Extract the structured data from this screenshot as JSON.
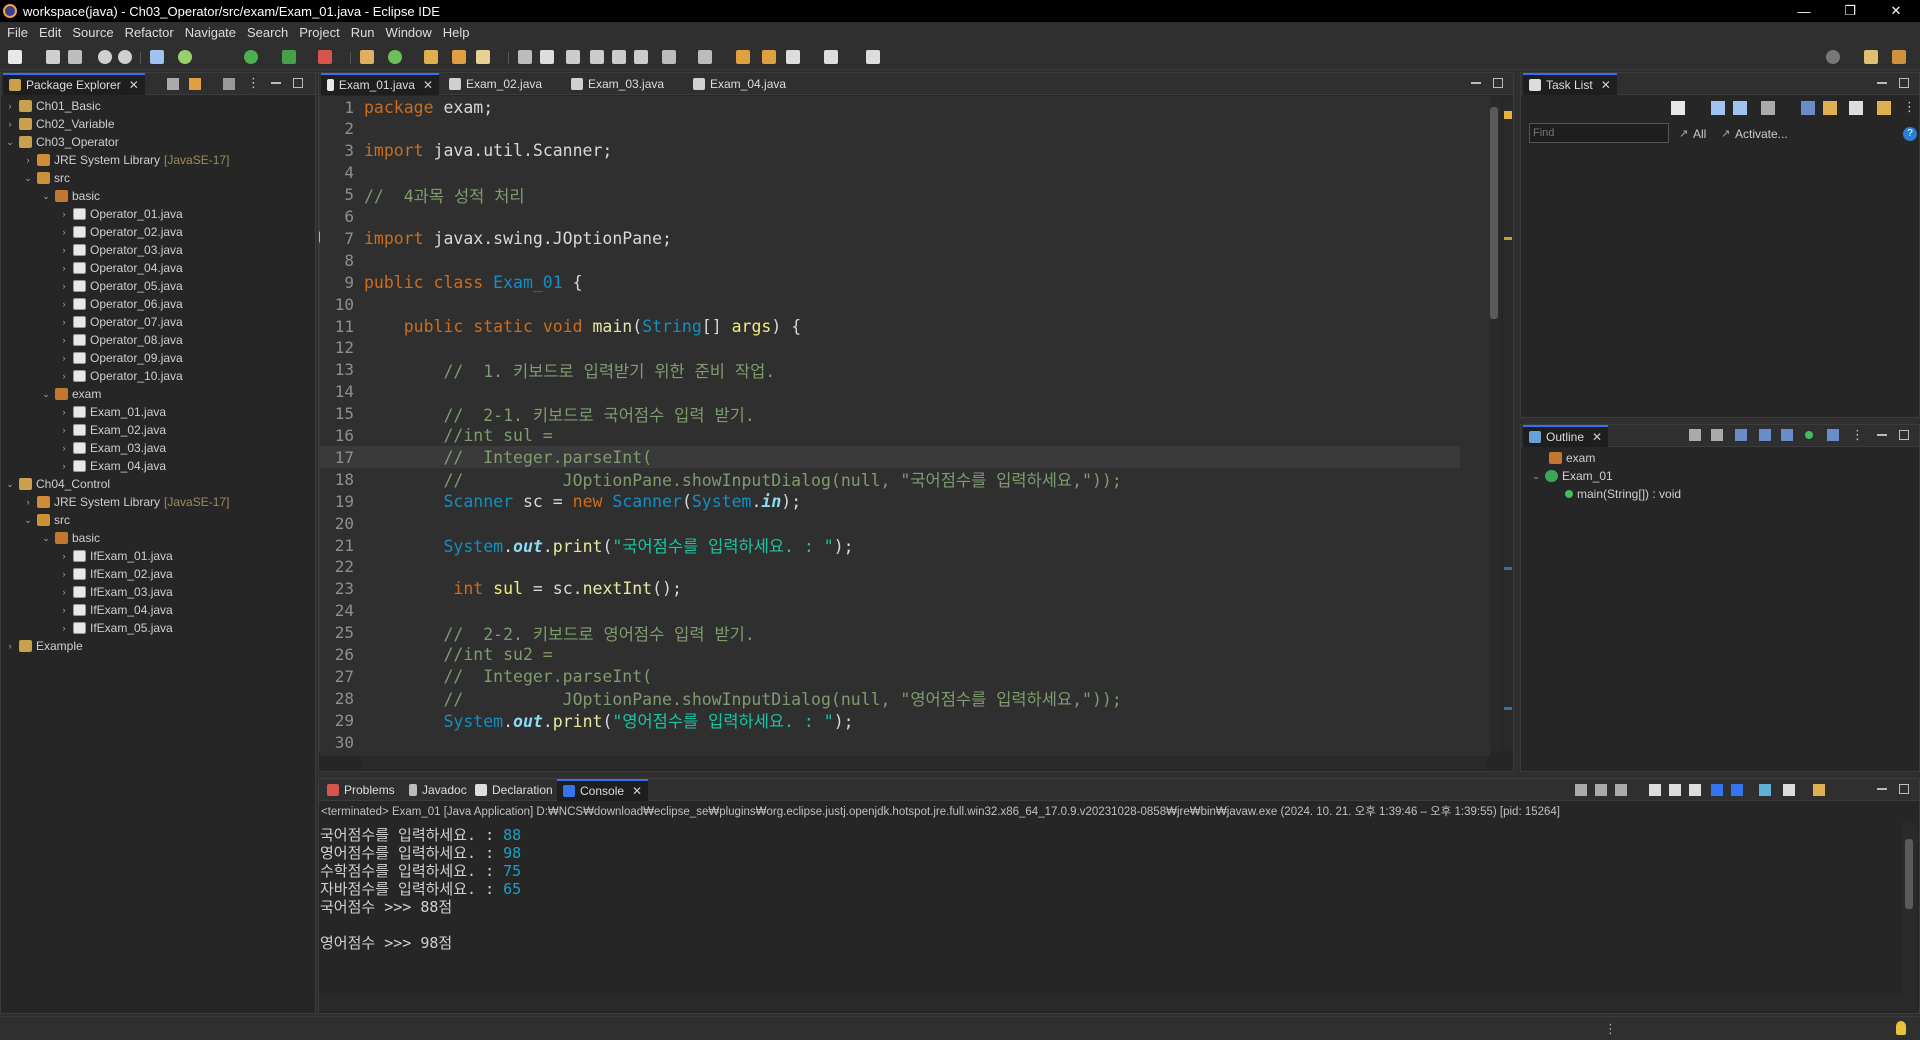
{
  "window": {
    "title": "workspace(java) - Ch03_Operator/src/exam/Exam_01.java - Eclipse IDE",
    "controls": [
      "—",
      "❐",
      "✕"
    ]
  },
  "menu": [
    "File",
    "Edit",
    "Source",
    "Refactor",
    "Navigate",
    "Search",
    "Project",
    "Run",
    "Window",
    "Help"
  ],
  "package_explorer": {
    "tab_label": "Package Explorer",
    "rows": [
      {
        "indent": 0,
        "twisty": "›",
        "icon": "proj",
        "label": "Ch01_Basic",
        "extra": ""
      },
      {
        "indent": 0,
        "twisty": "›",
        "icon": "proj",
        "label": "Ch02_Variable",
        "extra": ""
      },
      {
        "indent": 0,
        "twisty": "⌄",
        "icon": "proj",
        "label": "Ch03_Operator",
        "extra": ""
      },
      {
        "indent": 1,
        "twisty": "›",
        "icon": "lib",
        "label": "JRE System Library",
        "extra": "[JavaSE-17]"
      },
      {
        "indent": 1,
        "twisty": "⌄",
        "icon": "src",
        "label": "src",
        "extra": ""
      },
      {
        "indent": 2,
        "twisty": "⌄",
        "icon": "pkg",
        "label": "basic",
        "extra": ""
      },
      {
        "indent": 3,
        "twisty": "›",
        "icon": "java",
        "label": "Operator_01.java",
        "extra": ""
      },
      {
        "indent": 3,
        "twisty": "›",
        "icon": "java",
        "label": "Operator_02.java",
        "extra": ""
      },
      {
        "indent": 3,
        "twisty": "›",
        "icon": "java",
        "label": "Operator_03.java",
        "extra": ""
      },
      {
        "indent": 3,
        "twisty": "›",
        "icon": "java",
        "label": "Operator_04.java",
        "extra": ""
      },
      {
        "indent": 3,
        "twisty": "›",
        "icon": "java",
        "label": "Operator_05.java",
        "extra": ""
      },
      {
        "indent": 3,
        "twisty": "›",
        "icon": "java",
        "label": "Operator_06.java",
        "extra": ""
      },
      {
        "indent": 3,
        "twisty": "›",
        "icon": "java",
        "label": "Operator_07.java",
        "extra": ""
      },
      {
        "indent": 3,
        "twisty": "›",
        "icon": "java",
        "label": "Operator_08.java",
        "extra": ""
      },
      {
        "indent": 3,
        "twisty": "›",
        "icon": "java",
        "label": "Operator_09.java",
        "extra": ""
      },
      {
        "indent": 3,
        "twisty": "›",
        "icon": "java",
        "label": "Operator_10.java",
        "extra": ""
      },
      {
        "indent": 2,
        "twisty": "⌄",
        "icon": "pkg",
        "label": "exam",
        "extra": ""
      },
      {
        "indent": 3,
        "twisty": "›",
        "icon": "java",
        "label": "Exam_01.java",
        "extra": ""
      },
      {
        "indent": 3,
        "twisty": "›",
        "icon": "java",
        "label": "Exam_02.java",
        "extra": ""
      },
      {
        "indent": 3,
        "twisty": "›",
        "icon": "java",
        "label": "Exam_03.java",
        "extra": ""
      },
      {
        "indent": 3,
        "twisty": "›",
        "icon": "java",
        "label": "Exam_04.java",
        "extra": ""
      },
      {
        "indent": 0,
        "twisty": "⌄",
        "icon": "proj",
        "label": "Ch04_Control",
        "extra": ""
      },
      {
        "indent": 1,
        "twisty": "›",
        "icon": "lib",
        "label": "JRE System Library",
        "extra": "[JavaSE-17]"
      },
      {
        "indent": 1,
        "twisty": "⌄",
        "icon": "src",
        "label": "src",
        "extra": ""
      },
      {
        "indent": 2,
        "twisty": "⌄",
        "icon": "pkg",
        "label": "basic",
        "extra": ""
      },
      {
        "indent": 3,
        "twisty": "›",
        "icon": "java",
        "label": "IfExam_01.java",
        "extra": ""
      },
      {
        "indent": 3,
        "twisty": "›",
        "icon": "java",
        "label": "IfExam_02.java",
        "extra": ""
      },
      {
        "indent": 3,
        "twisty": "›",
        "icon": "java",
        "label": "IfExam_03.java",
        "extra": ""
      },
      {
        "indent": 3,
        "twisty": "›",
        "icon": "java",
        "label": "IfExam_04.java",
        "extra": ""
      },
      {
        "indent": 3,
        "twisty": "›",
        "icon": "java",
        "label": "IfExam_05.java",
        "extra": ""
      },
      {
        "indent": 0,
        "twisty": "›",
        "icon": "proj",
        "label": "Example",
        "extra": ""
      }
    ]
  },
  "editor": {
    "tabs": [
      "Exam_01.java",
      "Exam_02.java",
      "Exam_03.java",
      "Exam_04.java"
    ],
    "lines": [
      [
        [
          "kw",
          "package"
        ],
        [
          "pl",
          " exam;"
        ]
      ],
      [],
      [
        [
          "kw",
          "import"
        ],
        [
          "pl",
          " java.util.Scanner;"
        ]
      ],
      [],
      [
        [
          "cm",
          "//  4과목 성적 처리"
        ]
      ],
      [],
      [
        [
          "kw",
          "import"
        ],
        [
          "pl",
          " javax.swing.JOptionPane;"
        ]
      ],
      [],
      [
        [
          "kw",
          "public class "
        ],
        [
          "ty",
          "Exam_01"
        ],
        [
          "pl",
          " {"
        ]
      ],
      [],
      [
        [
          "pl",
          "    "
        ],
        [
          "kw",
          "public static void "
        ],
        [
          "mt",
          "main"
        ],
        [
          "pl",
          "("
        ],
        [
          "ty",
          "String"
        ],
        [
          "pl",
          "[] "
        ],
        [
          "var",
          "args"
        ],
        [
          "pl",
          ") {"
        ]
      ],
      [],
      [
        [
          "cm",
          "        //  1. 키보드로 입력받기 위한 준비 작업."
        ]
      ],
      [],
      [
        [
          "cm",
          "        //  2-1. 키보드로 국어점수 입력 받기."
        ]
      ],
      [
        [
          "cm",
          "        //int sul ="
        ]
      ],
      [
        [
          "cm",
          "        //  Integer.parseInt("
        ]
      ],
      [
        [
          "cm",
          "        //          JOptionPane.showInputDialog(null, \"국어점수를 입력하세요,\"));"
        ]
      ],
      [
        [
          "pl",
          "        "
        ],
        [
          "ty",
          "Scanner"
        ],
        [
          "pl",
          " sc = "
        ],
        [
          "kw",
          "new "
        ],
        [
          "ty",
          "Scanner"
        ],
        [
          "pl",
          "("
        ],
        [
          "ty",
          "System"
        ],
        [
          "pl",
          "."
        ],
        [
          "fld",
          "in"
        ],
        [
          "pl",
          ");"
        ]
      ],
      [],
      [
        [
          "pl",
          "        "
        ],
        [
          "ty",
          "System"
        ],
        [
          "pl",
          "."
        ],
        [
          "fld",
          "out"
        ],
        [
          "pl",
          "."
        ],
        [
          "mt",
          "print"
        ],
        [
          "pl",
          "("
        ],
        [
          "str",
          "\"국어점수를 입력하세요. : \""
        ],
        [
          "pl",
          ");"
        ]
      ],
      [],
      [
        [
          "pl",
          "         "
        ],
        [
          "kw",
          "int "
        ],
        [
          "var",
          "sul"
        ],
        [
          "pl",
          " = sc."
        ],
        [
          "mt",
          "nextInt"
        ],
        [
          "pl",
          "();"
        ]
      ],
      [],
      [
        [
          "cm",
          "        //  2-2. 키보드로 영어점수 입력 받기."
        ]
      ],
      [
        [
          "cm",
          "        //int su2 ="
        ]
      ],
      [
        [
          "cm",
          "        //  Integer.parseInt("
        ]
      ],
      [
        [
          "cm",
          "        //          JOptionPane.showInputDialog(null, \"영어점수를 입력하세요,\"));"
        ]
      ],
      [
        [
          "pl",
          "        "
        ],
        [
          "ty",
          "System"
        ],
        [
          "pl",
          "."
        ],
        [
          "fld",
          "out"
        ],
        [
          "pl",
          "."
        ],
        [
          "mt",
          "print"
        ],
        [
          "pl",
          "("
        ],
        [
          "str",
          "\"영어점수를 입력하세요. : \""
        ],
        [
          "pl",
          ");"
        ]
      ],
      []
    ]
  },
  "task_list": {
    "tab_label": "Task List",
    "find_placeholder": "Find",
    "all_label": "All",
    "activate_label": "Activate..."
  },
  "outline": {
    "tab_label": "Outline",
    "package": "exam",
    "class": "Exam_01",
    "method": "main(String[]) : void"
  },
  "bottom": {
    "tabs": [
      "Problems",
      "Javadoc",
      "Declaration",
      "Console"
    ],
    "status_line": "<terminated> Exam_01 [Java Application] D:₩NCS₩download₩eclipse_se₩plugins₩org.eclipse.justj.openjdk.hotspot.jre.full.win32.x86_64_17.0.9.v20231028-0858₩jre₩bin₩javaw.exe  (2024. 10. 21. 오후 1:39:46 – 오후 1:39:55) [pid: 15264]",
    "console": [
      {
        "text": "국어점수를 입력하세요. : ",
        "input": "88"
      },
      {
        "text": "영어점수를 입력하세요. : ",
        "input": "98"
      },
      {
        "text": "수학점수를 입력하세요. : ",
        "input": "75"
      },
      {
        "text": "자바점수를 입력하세요. : ",
        "input": "65"
      },
      {
        "text": "국어점수 >>> 88점",
        "input": ""
      },
      {
        "text": "",
        "input": ""
      },
      {
        "text": "영어점수 >>> 98점",
        "input": ""
      }
    ]
  }
}
